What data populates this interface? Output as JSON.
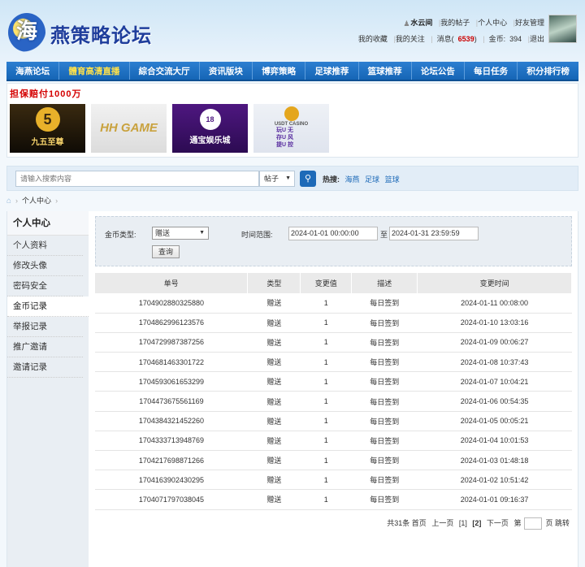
{
  "header": {
    "logo_mark": "海",
    "logo_text": "燕策略论坛",
    "username": "水云间",
    "links_row1": [
      "我的帖子",
      "个人中心",
      "好友管理"
    ],
    "links_row2": [
      "我的收藏",
      "我的关注"
    ],
    "msg_label": "消息",
    "msg_count": "6539",
    "coins_label": "金币",
    "coins_value": "394",
    "logout": "退出"
  },
  "nav": [
    "海燕论坛",
    "體育高清直播",
    "綜合交流大厅",
    "资讯版块",
    "博弈策略",
    "足球推荐",
    "篮球推荐",
    "论坛公告",
    "每日任务",
    "积分排行榜"
  ],
  "nav_active_index": 1,
  "ads": {
    "title": "担保赔付1000万",
    "items": [
      {
        "mark": "5",
        "text": "九五至尊"
      },
      {
        "text": "HH GAME"
      },
      {
        "mark": "18",
        "text": "通宝娱乐城"
      },
      {
        "text": "USDT CASINO",
        "rows": [
          "玩U 无",
          "存U 风",
          "提U 控"
        ]
      }
    ]
  },
  "search": {
    "placeholder": "请输入搜索内容",
    "select_value": "帖子",
    "hot_label": "热搜:",
    "hot_words": [
      "海燕",
      "足球",
      "篮球"
    ]
  },
  "breadcrumb": {
    "current": "个人中心"
  },
  "sidebar": {
    "title": "个人中心",
    "items": [
      "个人资料",
      "修改头像",
      "密码安全",
      "金币记录",
      "举报记录",
      "推广邀请",
      "邀请记录"
    ],
    "active_index": 3
  },
  "filter": {
    "type_label": "金币类型:",
    "type_value": "赠送",
    "range_label": "时间范围:",
    "start": "2024-01-01 00:00:00",
    "to": "至",
    "end": "2024-01-31 23:59:59",
    "query_button": "查询"
  },
  "table": {
    "headers": [
      "单号",
      "类型",
      "变更值",
      "描述",
      "变更时间"
    ],
    "rows": [
      [
        "1704902880325880",
        "赠送",
        "1",
        "每日签到",
        "2024-01-11 00:08:00"
      ],
      [
        "1704862996123576",
        "赠送",
        "1",
        "每日签到",
        "2024-01-10 13:03:16"
      ],
      [
        "1704729987387256",
        "赠送",
        "1",
        "每日签到",
        "2024-01-09 00:06:27"
      ],
      [
        "1704681463301722",
        "赠送",
        "1",
        "每日签到",
        "2024-01-08 10:37:43"
      ],
      [
        "1704593061653299",
        "赠送",
        "1",
        "每日签到",
        "2024-01-07 10:04:21"
      ],
      [
        "1704473675561169",
        "赠送",
        "1",
        "每日签到",
        "2024-01-06 00:54:35"
      ],
      [
        "1704384321452260",
        "赠送",
        "1",
        "每日签到",
        "2024-01-05 00:05:21"
      ],
      [
        "1704333713948769",
        "赠送",
        "1",
        "每日签到",
        "2024-01-04 10:01:53"
      ],
      [
        "1704217698871266",
        "赠送",
        "1",
        "每日签到",
        "2024-01-03 01:48:18"
      ],
      [
        "1704163902430295",
        "赠送",
        "1",
        "每日签到",
        "2024-01-02 10:51:42"
      ],
      [
        "1704071797038045",
        "赠送",
        "1",
        "每日签到",
        "2024-01-01 09:16:37"
      ]
    ]
  },
  "pager": {
    "total": "共31条",
    "first": "首页",
    "prev": "上一页",
    "page1": "[1]",
    "page2": "[2]",
    "next": "下一页",
    "goto_pre": "第",
    "goto_post": "页",
    "jump": "跳转"
  }
}
